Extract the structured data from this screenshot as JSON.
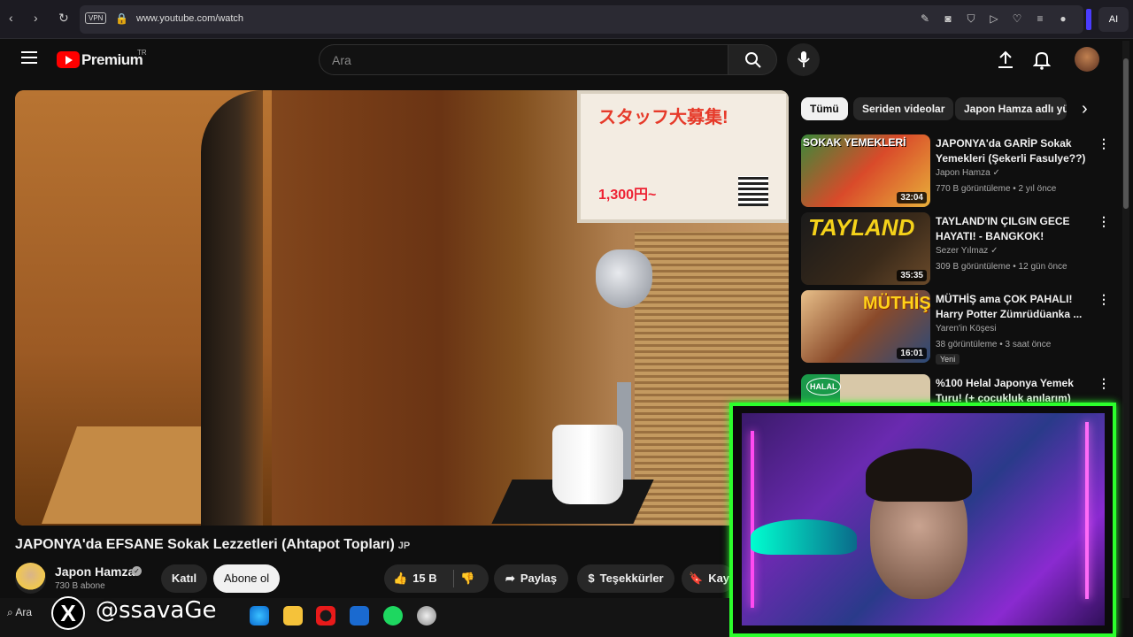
{
  "browser": {
    "url": "www.youtube.com/watch",
    "vpn_label": "VPN",
    "ai_label": "AI"
  },
  "header": {
    "brand": "Premium",
    "brand_sup": "TR",
    "search_placeholder": "Ara"
  },
  "video": {
    "title": "JAPONYA'da EFSANE Sokak Lezzetleri (Ahtapot Topları)",
    "title_badge": "JP",
    "poster_heading": "スタッフ大募集!",
    "poster_price": "1,300円~",
    "channel_name": "Japon Hamza",
    "subscribers": "730 B abone",
    "join_label": "Katıl",
    "subscribe_label": "Abone ol",
    "likes": "15 B",
    "share_label": "Paylaş",
    "thanks_label": "Teşekkürler",
    "save_label": "Kay"
  },
  "sidebar": {
    "chips": [
      "Tümü",
      "Seriden videolar",
      "Japon Hamza adlı yü"
    ],
    "recommendations": [
      {
        "title": "JAPONYA'da GARİP Sokak Yemekleri (Şekerli Fasulye??)",
        "channel": "Japon Hamza",
        "meta": "770 B görüntüleme • 2 yıl önce",
        "duration": "32:04",
        "thumb_text": "SOKAK YEMEKLERİ"
      },
      {
        "title": "TAYLAND'IN ÇILGIN GECE HAYATI! - BANGKOK!",
        "channel": "Sezer Yılmaz",
        "meta": "309 B görüntüleme • 12 gün önce",
        "duration": "35:35",
        "thumb_text": "TAYLAND"
      },
      {
        "title": "MÜTHİŞ ama ÇOK PAHALI! Harry Potter Zümrüdüanka ...",
        "channel": "Yaren'in Köşesi",
        "meta": "38 görüntüleme • 3 saat önce",
        "duration": "16:01",
        "thumb_text": "MÜTHİŞ",
        "badge": "Yeni"
      },
      {
        "title": "%100 Helal Japonya Yemek Turu! (+ çocukluk anılarım)",
        "channel": "",
        "meta": "",
        "duration": "",
        "thumb_text": "HALAL"
      }
    ]
  },
  "overlay": {
    "handle": "@ssavaGe"
  },
  "taskbar": {
    "search_label": "Ara"
  }
}
